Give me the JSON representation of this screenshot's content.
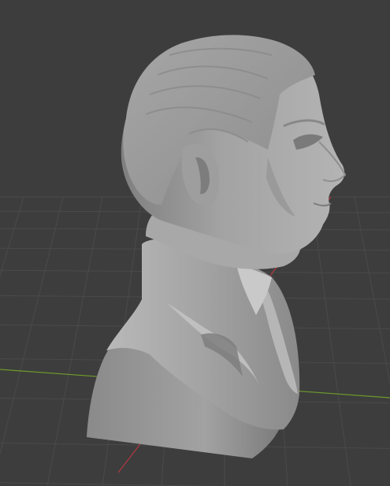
{
  "viewport": {
    "background": "#3d3d3d",
    "grid_color": "#4a4a4a",
    "x_axis_color": "#b0383f",
    "y_axis_color": "#6e9b2b",
    "object": "bust-sculpture",
    "object_color": "#9b9b9b"
  }
}
